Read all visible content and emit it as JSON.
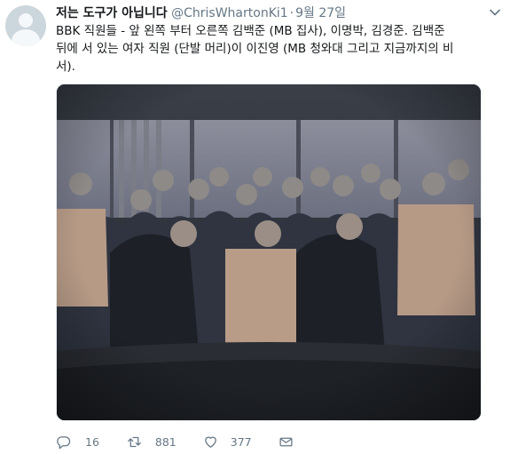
{
  "tweet": {
    "author_name": "저는 도구가 아닙니다",
    "author_handle": "@ChrisWhartonKi1",
    "separator": "·",
    "date": "9월 27일",
    "text": "BBK 직원들 - 앞 왼쪽 부터 오른쪽 김백준 (MB 집사), 이명박, 김경준. 김백준\n뒤에 서 있는 여자 직원 (단발 머리)이 이진영 (MB 청와대 그리고 지금까지의 비\n서).",
    "media_description": "group photo of BBK staff"
  },
  "actions": {
    "reply_count": "16",
    "retweet_count": "881",
    "like_count": "377"
  },
  "icons": {
    "avatar": "default-avatar-icon",
    "caret": "chevron-down-icon",
    "reply": "reply-icon",
    "retweet": "retweet-icon",
    "like": "heart-icon",
    "message": "envelope-icon"
  },
  "colors": {
    "text": "#14171a",
    "muted": "#657786",
    "border": "#e6ecf0",
    "avatar_bg": "#ccd6dd"
  }
}
